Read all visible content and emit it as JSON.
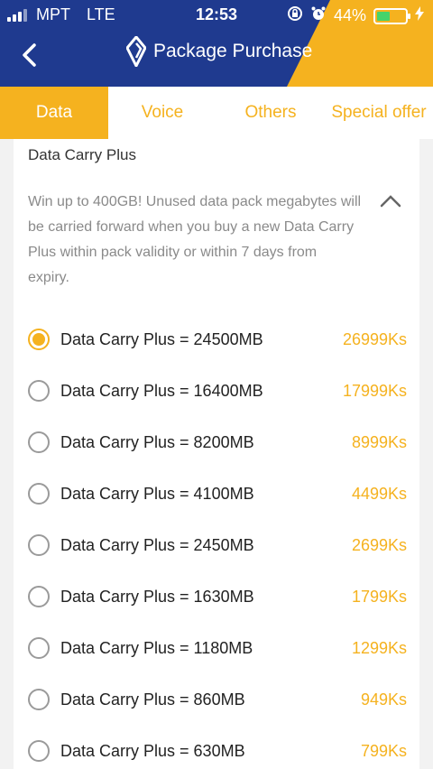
{
  "status": {
    "carrier": "MPT",
    "network": "LTE",
    "time": "12:53",
    "battery": "44%"
  },
  "header": {
    "title": "Package Purchase",
    "back_icon": "chevron-left-icon",
    "logo_icon": "brand-logo-icon"
  },
  "tabs": [
    {
      "label": "Data",
      "active": true
    },
    {
      "label": "Voice",
      "active": false
    },
    {
      "label": "Others",
      "active": false
    },
    {
      "label": "Special offer",
      "active": false
    }
  ],
  "section": {
    "title": "Data Carry Plus",
    "description": "Win up to 400GB! Unused data pack megabytes will be carried forward when you buy a new Data Carry Plus within pack validity or within 7 days from expiry."
  },
  "packages": [
    {
      "label": "Data Carry Plus = 24500MB",
      "price": "26999Ks",
      "selected": true
    },
    {
      "label": "Data Carry Plus = 16400MB",
      "price": "17999Ks",
      "selected": false
    },
    {
      "label": "Data Carry Plus = 8200MB",
      "price": "8999Ks",
      "selected": false
    },
    {
      "label": "Data Carry Plus = 4100MB",
      "price": "4499Ks",
      "selected": false
    },
    {
      "label": "Data Carry Plus = 2450MB",
      "price": "2699Ks",
      "selected": false
    },
    {
      "label": "Data Carry Plus = 1630MB",
      "price": "1799Ks",
      "selected": false
    },
    {
      "label": "Data Carry Plus = 1180MB",
      "price": "1299Ks",
      "selected": false
    },
    {
      "label": "Data Carry Plus = 860MB",
      "price": "949Ks",
      "selected": false
    },
    {
      "label": "Data Carry Plus = 630MB",
      "price": "799Ks",
      "selected": false
    }
  ],
  "colors": {
    "primary": "#1f3a8f",
    "accent": "#f5b21f"
  }
}
